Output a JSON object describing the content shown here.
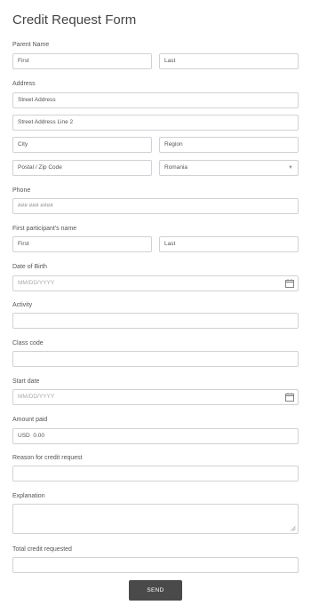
{
  "form": {
    "title": "Credit Request Form",
    "parent_name": {
      "label": "Parent Name",
      "first": "First",
      "last": "Last"
    },
    "address": {
      "label": "Address",
      "street": "Street Address",
      "street2": "Street Address Line 2",
      "city": "City",
      "region": "Region",
      "postal": "Postal / Zip Code",
      "country": "Romania"
    },
    "phone": {
      "label": "Phone",
      "placeholder": "### ### ####"
    },
    "participant": {
      "label": "First participant's name",
      "first": "First",
      "last": "Last"
    },
    "dob": {
      "label": "Date of Birth",
      "placeholder": "MM/DD/YYYY"
    },
    "activity": {
      "label": "Activity"
    },
    "class_code": {
      "label": "Class code"
    },
    "start_date": {
      "label": "Start date",
      "placeholder": "MM/DD/YYYY"
    },
    "amount_paid": {
      "label": "Amount paid",
      "value": "USD  0.00"
    },
    "reason": {
      "label": "Reason for credit request"
    },
    "explanation": {
      "label": "Explanation"
    },
    "total_credit": {
      "label": "Total credit requested"
    },
    "send_label": "SEND"
  },
  "icons": {
    "calendar": "calendar-icon",
    "dropdown": "chevron-down-icon",
    "resize": "resize-handle-icon"
  },
  "colors": {
    "border": "#cfd2d6",
    "button_bg": "#4a4a4a",
    "button_text": "#ffffff"
  }
}
